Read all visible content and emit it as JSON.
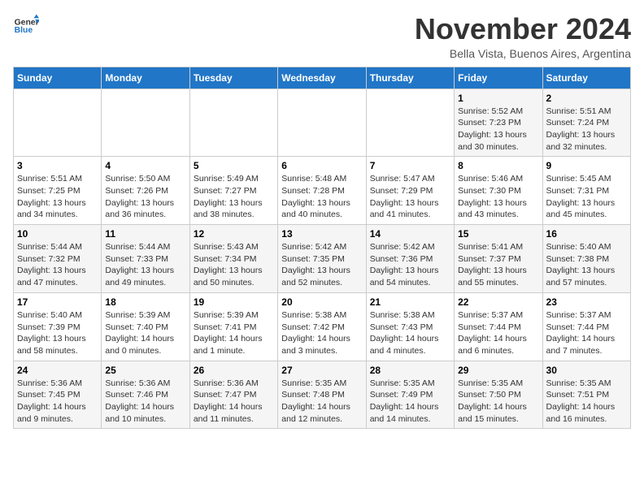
{
  "logo": {
    "line1": "General",
    "line2": "Blue"
  },
  "title": "November 2024",
  "location": "Bella Vista, Buenos Aires, Argentina",
  "weekdays": [
    "Sunday",
    "Monday",
    "Tuesday",
    "Wednesday",
    "Thursday",
    "Friday",
    "Saturday"
  ],
  "weeks": [
    [
      {
        "day": "",
        "info": ""
      },
      {
        "day": "",
        "info": ""
      },
      {
        "day": "",
        "info": ""
      },
      {
        "day": "",
        "info": ""
      },
      {
        "day": "",
        "info": ""
      },
      {
        "day": "1",
        "info": "Sunrise: 5:52 AM\nSunset: 7:23 PM\nDaylight: 13 hours\nand 30 minutes."
      },
      {
        "day": "2",
        "info": "Sunrise: 5:51 AM\nSunset: 7:24 PM\nDaylight: 13 hours\nand 32 minutes."
      }
    ],
    [
      {
        "day": "3",
        "info": "Sunrise: 5:51 AM\nSunset: 7:25 PM\nDaylight: 13 hours\nand 34 minutes."
      },
      {
        "day": "4",
        "info": "Sunrise: 5:50 AM\nSunset: 7:26 PM\nDaylight: 13 hours\nand 36 minutes."
      },
      {
        "day": "5",
        "info": "Sunrise: 5:49 AM\nSunset: 7:27 PM\nDaylight: 13 hours\nand 38 minutes."
      },
      {
        "day": "6",
        "info": "Sunrise: 5:48 AM\nSunset: 7:28 PM\nDaylight: 13 hours\nand 40 minutes."
      },
      {
        "day": "7",
        "info": "Sunrise: 5:47 AM\nSunset: 7:29 PM\nDaylight: 13 hours\nand 41 minutes."
      },
      {
        "day": "8",
        "info": "Sunrise: 5:46 AM\nSunset: 7:30 PM\nDaylight: 13 hours\nand 43 minutes."
      },
      {
        "day": "9",
        "info": "Sunrise: 5:45 AM\nSunset: 7:31 PM\nDaylight: 13 hours\nand 45 minutes."
      }
    ],
    [
      {
        "day": "10",
        "info": "Sunrise: 5:44 AM\nSunset: 7:32 PM\nDaylight: 13 hours\nand 47 minutes."
      },
      {
        "day": "11",
        "info": "Sunrise: 5:44 AM\nSunset: 7:33 PM\nDaylight: 13 hours\nand 49 minutes."
      },
      {
        "day": "12",
        "info": "Sunrise: 5:43 AM\nSunset: 7:34 PM\nDaylight: 13 hours\nand 50 minutes."
      },
      {
        "day": "13",
        "info": "Sunrise: 5:42 AM\nSunset: 7:35 PM\nDaylight: 13 hours\nand 52 minutes."
      },
      {
        "day": "14",
        "info": "Sunrise: 5:42 AM\nSunset: 7:36 PM\nDaylight: 13 hours\nand 54 minutes."
      },
      {
        "day": "15",
        "info": "Sunrise: 5:41 AM\nSunset: 7:37 PM\nDaylight: 13 hours\nand 55 minutes."
      },
      {
        "day": "16",
        "info": "Sunrise: 5:40 AM\nSunset: 7:38 PM\nDaylight: 13 hours\nand 57 minutes."
      }
    ],
    [
      {
        "day": "17",
        "info": "Sunrise: 5:40 AM\nSunset: 7:39 PM\nDaylight: 13 hours\nand 58 minutes."
      },
      {
        "day": "18",
        "info": "Sunrise: 5:39 AM\nSunset: 7:40 PM\nDaylight: 14 hours\nand 0 minutes."
      },
      {
        "day": "19",
        "info": "Sunrise: 5:39 AM\nSunset: 7:41 PM\nDaylight: 14 hours\nand 1 minute."
      },
      {
        "day": "20",
        "info": "Sunrise: 5:38 AM\nSunset: 7:42 PM\nDaylight: 14 hours\nand 3 minutes."
      },
      {
        "day": "21",
        "info": "Sunrise: 5:38 AM\nSunset: 7:43 PM\nDaylight: 14 hours\nand 4 minutes."
      },
      {
        "day": "22",
        "info": "Sunrise: 5:37 AM\nSunset: 7:44 PM\nDaylight: 14 hours\nand 6 minutes."
      },
      {
        "day": "23",
        "info": "Sunrise: 5:37 AM\nSunset: 7:44 PM\nDaylight: 14 hours\nand 7 minutes."
      }
    ],
    [
      {
        "day": "24",
        "info": "Sunrise: 5:36 AM\nSunset: 7:45 PM\nDaylight: 14 hours\nand 9 minutes."
      },
      {
        "day": "25",
        "info": "Sunrise: 5:36 AM\nSunset: 7:46 PM\nDaylight: 14 hours\nand 10 minutes."
      },
      {
        "day": "26",
        "info": "Sunrise: 5:36 AM\nSunset: 7:47 PM\nDaylight: 14 hours\nand 11 minutes."
      },
      {
        "day": "27",
        "info": "Sunrise: 5:35 AM\nSunset: 7:48 PM\nDaylight: 14 hours\nand 12 minutes."
      },
      {
        "day": "28",
        "info": "Sunrise: 5:35 AM\nSunset: 7:49 PM\nDaylight: 14 hours\nand 14 minutes."
      },
      {
        "day": "29",
        "info": "Sunrise: 5:35 AM\nSunset: 7:50 PM\nDaylight: 14 hours\nand 15 minutes."
      },
      {
        "day": "30",
        "info": "Sunrise: 5:35 AM\nSunset: 7:51 PM\nDaylight: 14 hours\nand 16 minutes."
      }
    ]
  ]
}
